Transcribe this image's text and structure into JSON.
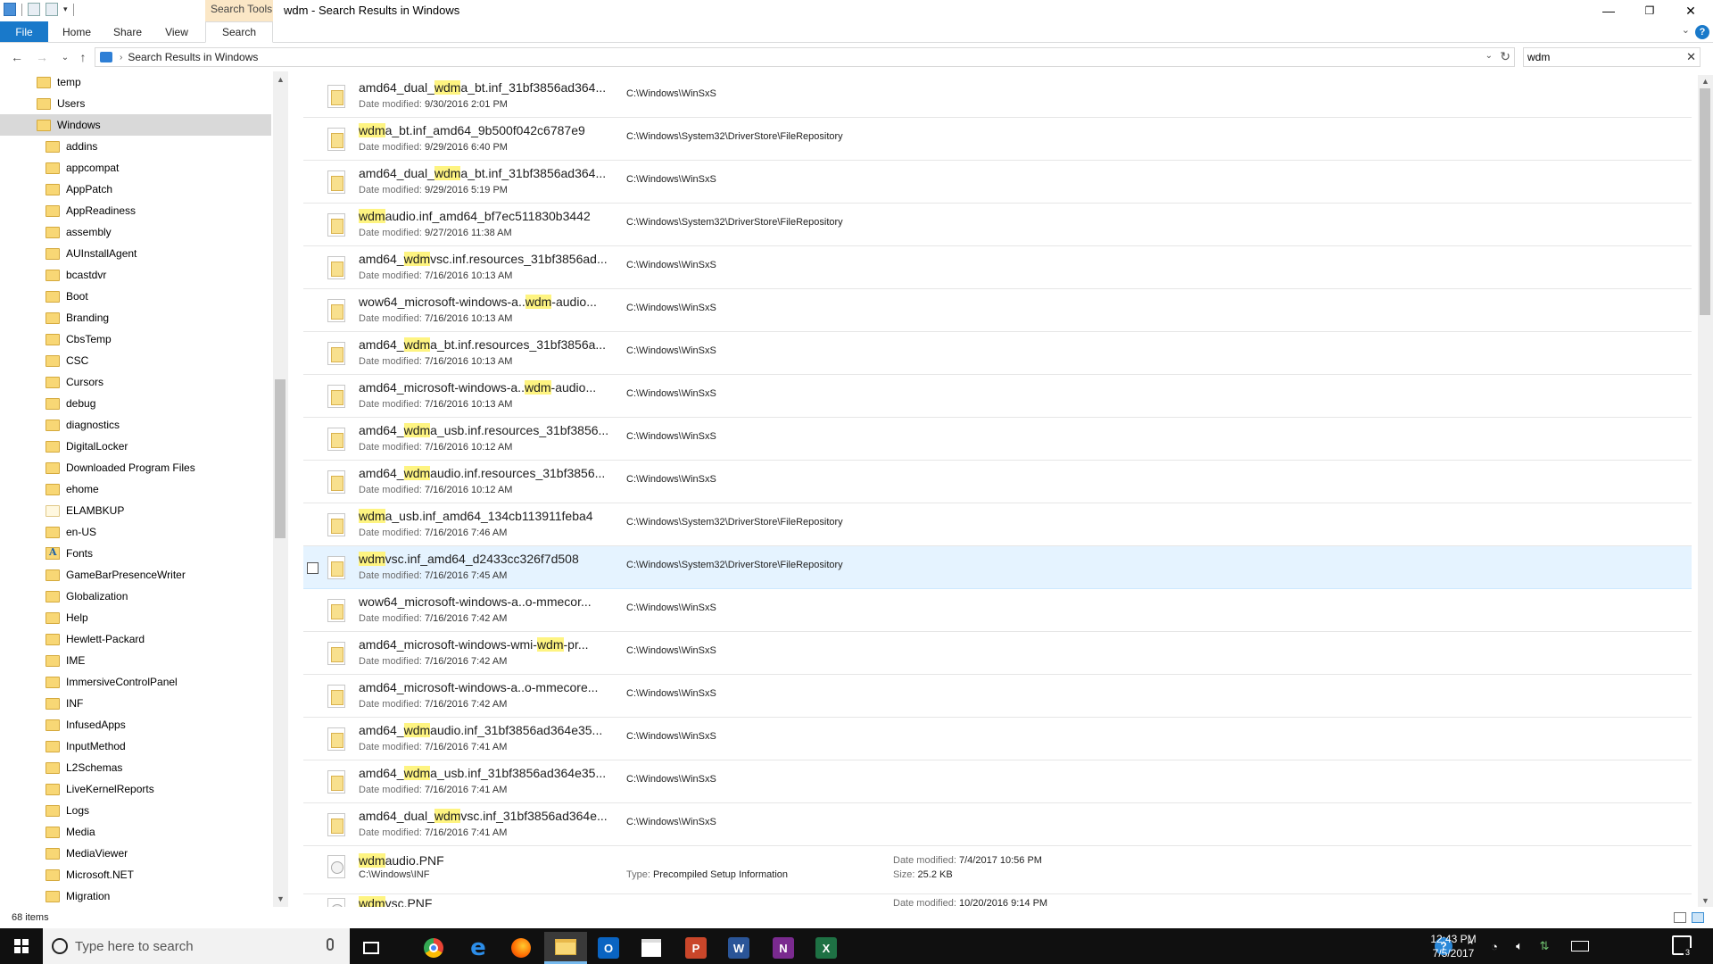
{
  "window": {
    "title": "wdm - Search Results in Windows",
    "context_tab": "Search Tools",
    "controls": {
      "minimize": "—",
      "maximize": "❐",
      "close": "✕"
    }
  },
  "ribbon": {
    "tabs": [
      {
        "label": "File"
      },
      {
        "label": "Home"
      },
      {
        "label": "Share"
      },
      {
        "label": "View"
      },
      {
        "label": "Search"
      }
    ],
    "help": "?"
  },
  "address": {
    "path": "Search Results in Windows",
    "search_value": "wdm"
  },
  "nav": {
    "items": [
      {
        "label": "temp",
        "level": 0
      },
      {
        "label": "Users",
        "level": 0
      },
      {
        "label": "Windows",
        "level": 0,
        "selected": true
      },
      {
        "label": "addins",
        "level": 1
      },
      {
        "label": "appcompat",
        "level": 1
      },
      {
        "label": "AppPatch",
        "level": 1
      },
      {
        "label": "AppReadiness",
        "level": 1
      },
      {
        "label": "assembly",
        "level": 1
      },
      {
        "label": "AUInstallAgent",
        "level": 1
      },
      {
        "label": "bcastdvr",
        "level": 1
      },
      {
        "label": "Boot",
        "level": 1
      },
      {
        "label": "Branding",
        "level": 1
      },
      {
        "label": "CbsTemp",
        "level": 1
      },
      {
        "label": "CSC",
        "level": 1
      },
      {
        "label": "Cursors",
        "level": 1
      },
      {
        "label": "debug",
        "level": 1
      },
      {
        "label": "diagnostics",
        "level": 1
      },
      {
        "label": "DigitalLocker",
        "level": 1
      },
      {
        "label": "Downloaded Program Files",
        "level": 1
      },
      {
        "label": "ehome",
        "level": 1
      },
      {
        "label": "ELAMBKUP",
        "level": 1,
        "plain": true
      },
      {
        "label": "en-US",
        "level": 1
      },
      {
        "label": "Fonts",
        "level": 1,
        "fonts": true
      },
      {
        "label": "GameBarPresenceWriter",
        "level": 1
      },
      {
        "label": "Globalization",
        "level": 1
      },
      {
        "label": "Help",
        "level": 1
      },
      {
        "label": "Hewlett-Packard",
        "level": 1
      },
      {
        "label": "IME",
        "level": 1
      },
      {
        "label": "ImmersiveControlPanel",
        "level": 1
      },
      {
        "label": "INF",
        "level": 1
      },
      {
        "label": "InfusedApps",
        "level": 1
      },
      {
        "label": "InputMethod",
        "level": 1
      },
      {
        "label": "L2Schemas",
        "level": 1
      },
      {
        "label": "LiveKernelReports",
        "level": 1
      },
      {
        "label": "Logs",
        "level": 1
      },
      {
        "label": "Media",
        "level": 1
      },
      {
        "label": "MediaViewer",
        "level": 1
      },
      {
        "label": "Microsoft.NET",
        "level": 1
      },
      {
        "label": "Migration",
        "level": 1
      }
    ]
  },
  "results": {
    "date_label": "Date modified:",
    "type_label": "Type:",
    "size_label": "Size:",
    "rows": [
      {
        "pre": "amd64_dual_",
        "hl": "wdm",
        "post": "a_bt.inf_31bf3856ad364...",
        "date": "9/30/2016 2:01 PM",
        "path": "C:\\Windows\\WinSxS"
      },
      {
        "pre": "",
        "hl": "wdm",
        "post": "a_bt.inf_amd64_9b500f042c6787e9",
        "date": "9/29/2016 6:40 PM",
        "path": "C:\\Windows\\System32\\DriverStore\\FileRepository"
      },
      {
        "pre": "amd64_dual_",
        "hl": "wdm",
        "post": "a_bt.inf_31bf3856ad364...",
        "date": "9/29/2016 5:19 PM",
        "path": "C:\\Windows\\WinSxS"
      },
      {
        "pre": "",
        "hl": "wdm",
        "post": "audio.inf_amd64_bf7ec511830b3442",
        "date": "9/27/2016 11:38 AM",
        "path": "C:\\Windows\\System32\\DriverStore\\FileRepository"
      },
      {
        "pre": "amd64_",
        "hl": "wdm",
        "post": "vsc.inf.resources_31bf3856ad...",
        "date": "7/16/2016 10:13 AM",
        "path": "C:\\Windows\\WinSxS"
      },
      {
        "pre": "wow64_microsoft-windows-a..",
        "hl": "wdm",
        "post": "-audio...",
        "date": "7/16/2016 10:13 AM",
        "path": "C:\\Windows\\WinSxS"
      },
      {
        "pre": "amd64_",
        "hl": "wdm",
        "post": "a_bt.inf.resources_31bf3856a...",
        "date": "7/16/2016 10:13 AM",
        "path": "C:\\Windows\\WinSxS"
      },
      {
        "pre": "amd64_microsoft-windows-a..",
        "hl": "wdm",
        "post": "-audio...",
        "date": "7/16/2016 10:13 AM",
        "path": "C:\\Windows\\WinSxS"
      },
      {
        "pre": "amd64_",
        "hl": "wdm",
        "post": "a_usb.inf.resources_31bf3856...",
        "date": "7/16/2016 10:12 AM",
        "path": "C:\\Windows\\WinSxS"
      },
      {
        "pre": "amd64_",
        "hl": "wdm",
        "post": "audio.inf.resources_31bf3856...",
        "date": "7/16/2016 10:12 AM",
        "path": "C:\\Windows\\WinSxS"
      },
      {
        "pre": "",
        "hl": "wdm",
        "post": "a_usb.inf_amd64_134cb113911feba4",
        "date": "7/16/2016 7:46 AM",
        "path": "C:\\Windows\\System32\\DriverStore\\FileRepository"
      },
      {
        "pre": "",
        "hl": "wdm",
        "post": "vsc.inf_amd64_d2433cc326f7d508",
        "date": "7/16/2016 7:45 AM",
        "path": "C:\\Windows\\System32\\DriverStore\\FileRepository",
        "hover": true
      },
      {
        "pre": "wow64_microsoft-windows-a..o-mmecor...",
        "hl": "",
        "post": "",
        "date": "7/16/2016 7:42 AM",
        "path": "C:\\Windows\\WinSxS"
      },
      {
        "pre": "amd64_microsoft-windows-wmi-",
        "hl": "wdm",
        "post": "-pr...",
        "date": "7/16/2016 7:42 AM",
        "path": "C:\\Windows\\WinSxS"
      },
      {
        "pre": "amd64_microsoft-windows-a..o-mmecore...",
        "hl": "",
        "post": "",
        "date": "7/16/2016 7:42 AM",
        "path": "C:\\Windows\\WinSxS"
      },
      {
        "pre": "amd64_",
        "hl": "wdm",
        "post": "audio.inf_31bf3856ad364e35...",
        "date": "7/16/2016 7:41 AM",
        "path": "C:\\Windows\\WinSxS"
      },
      {
        "pre": "amd64_",
        "hl": "wdm",
        "post": "a_usb.inf_31bf3856ad364e35...",
        "date": "7/16/2016 7:41 AM",
        "path": "C:\\Windows\\WinSxS"
      },
      {
        "pre": "amd64_dual_",
        "hl": "wdm",
        "post": "vsc.inf_31bf3856ad364e...",
        "date": "7/16/2016 7:41 AM",
        "path": "C:\\Windows\\WinSxS"
      }
    ],
    "file_rows": [
      {
        "hl": "wdm",
        "post": "audio.PNF",
        "location": "C:\\Windows\\INF",
        "type": "Precompiled Setup Information",
        "date": "7/4/2017 10:56 PM",
        "size": "25.2 KB"
      },
      {
        "hl": "wdm",
        "post": "vsc.PNF",
        "location": "",
        "type": "",
        "date": "10/20/2016 9:14 PM",
        "size": ""
      }
    ]
  },
  "status": {
    "count": "68 items"
  },
  "taskbar": {
    "search_placeholder": "Type here to search",
    "apps": [
      "task-view",
      "chrome",
      "edge",
      "firefox",
      "file-explorer",
      "outlook",
      "store",
      "powerpoint",
      "word",
      "onenote",
      "excel"
    ],
    "time": "12:43 PM",
    "date": "7/5/2017",
    "notification_count": "3"
  },
  "colors": {
    "accent": "#1979ca",
    "highlight": "#fef481",
    "hover_row": "#e5f3ff",
    "context_tab": "#fbe7c6"
  }
}
